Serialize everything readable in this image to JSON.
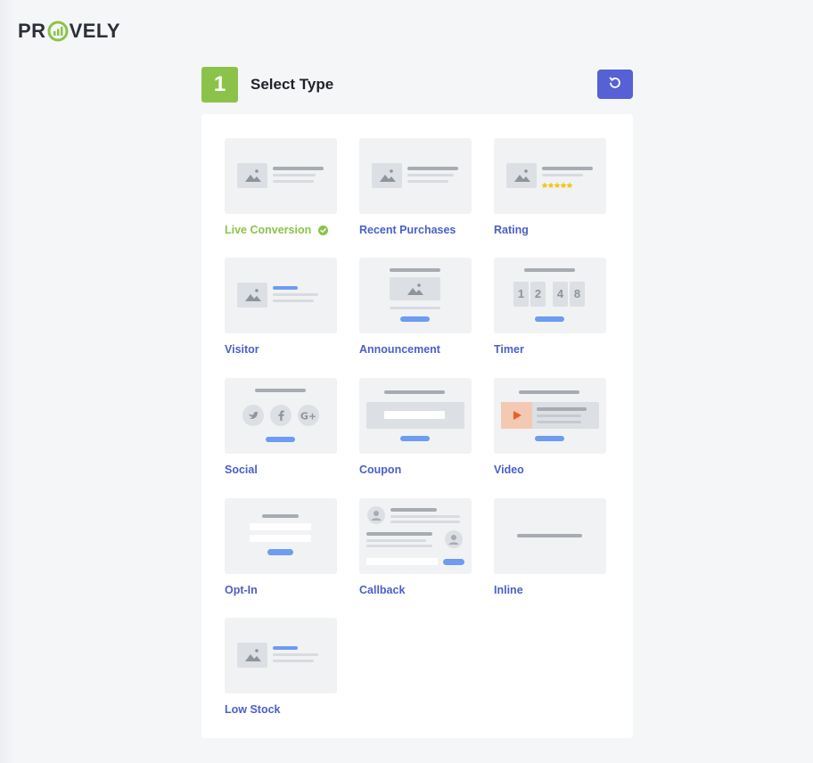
{
  "brand": {
    "logo_text_left": "PR",
    "logo_text_right": "VELY",
    "accent": "#8bc34a"
  },
  "header": {
    "step_number": "1",
    "step_title": "Select Type",
    "reset_icon": "undo-icon"
  },
  "colors": {
    "primary": "#5561d5",
    "label": "#4b5fc9",
    "active": "#8bc34a",
    "thumb_bg": "#f1f2f4"
  },
  "types": [
    {
      "label": "Live Conversion",
      "selected": true
    },
    {
      "label": "Recent Purchases",
      "selected": false
    },
    {
      "label": "Rating",
      "selected": false
    },
    {
      "label": "Visitor",
      "selected": false
    },
    {
      "label": "Announcement",
      "selected": false
    },
    {
      "label": "Timer",
      "selected": false,
      "digits": [
        "1",
        "2",
        "4",
        "8"
      ]
    },
    {
      "label": "Social",
      "selected": false
    },
    {
      "label": "Coupon",
      "selected": false
    },
    {
      "label": "Video",
      "selected": false
    },
    {
      "label": "Opt-In",
      "selected": false
    },
    {
      "label": "Callback",
      "selected": false
    },
    {
      "label": "Inline",
      "selected": false
    },
    {
      "label": "Low Stock",
      "selected": false
    }
  ]
}
